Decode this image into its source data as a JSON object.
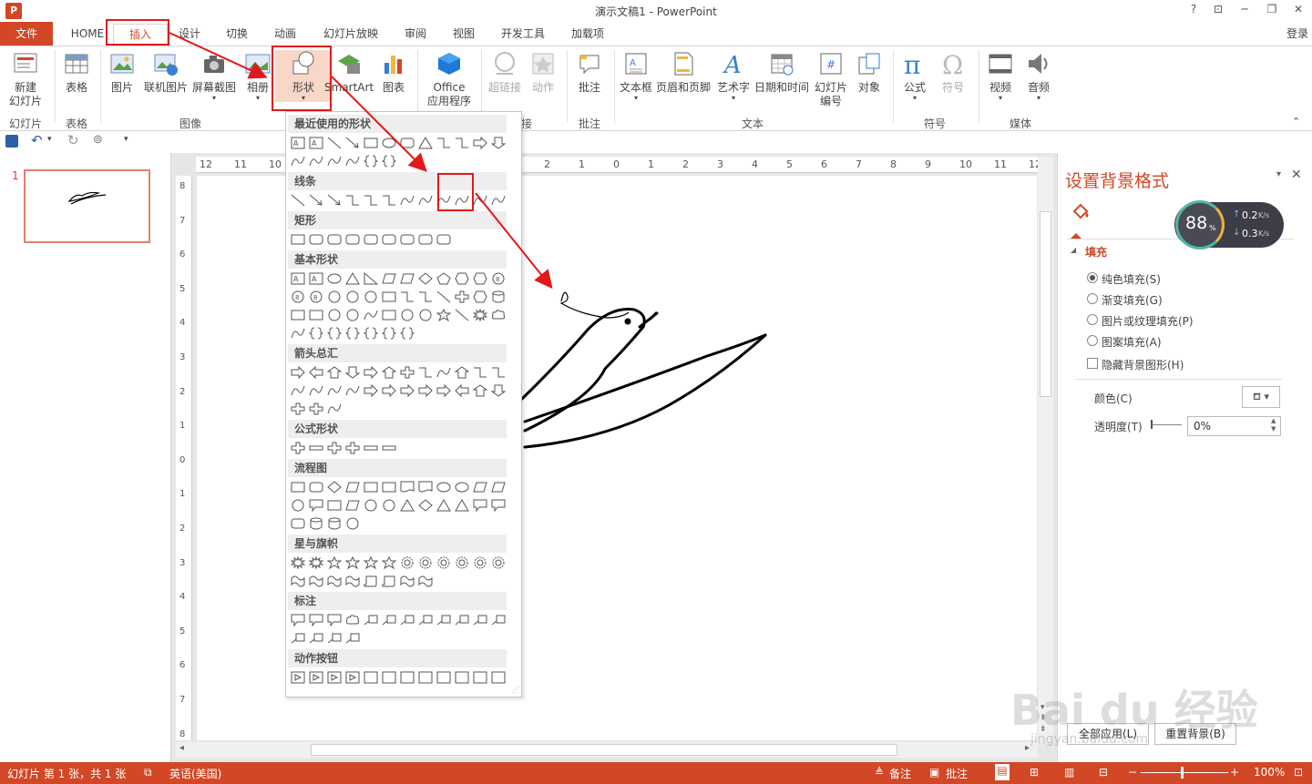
{
  "window": {
    "title": "演示文稿1 - PowerPoint",
    "app_icon": "P",
    "help": "?",
    "login": "登录"
  },
  "tabs": [
    {
      "label": "文件"
    },
    {
      "label": "HOME"
    },
    {
      "label": "插入"
    },
    {
      "label": "设计"
    },
    {
      "label": "切换"
    },
    {
      "label": "动画"
    },
    {
      "label": "幻灯片放映"
    },
    {
      "label": "审阅"
    },
    {
      "label": "视图"
    },
    {
      "label": "开发工具"
    },
    {
      "label": "加载项"
    }
  ],
  "ribbon": {
    "buttons": {
      "new_slide": "新建\n幻灯片",
      "table": "表格",
      "picture": "图片",
      "online_picture": "联机图片",
      "screenshot": "屏幕截图",
      "album": "相册",
      "shapes": "形状",
      "smartart": "SmartArt",
      "chart": "图表",
      "office_apps": "Office\n应用程序",
      "hyperlink": "超链接",
      "action": "动作",
      "comment": "批注",
      "textbox": "文本框",
      "header_footer": "页眉和页脚",
      "wordart": "艺术字",
      "datetime": "日期和时间",
      "slide_number": "幻灯片\n编号",
      "object": "对象",
      "equation": "公式",
      "symbol": "符号",
      "video": "视频",
      "audio": "音频"
    },
    "groups": {
      "slides": "幻灯片",
      "tables": "表格",
      "images": "图像",
      "links": "接",
      "comments": "批注",
      "text": "文本",
      "symbols": "符号",
      "media": "媒体"
    }
  },
  "shapes_menu": {
    "categories": {
      "recent": "最近使用的形状",
      "lines": "线条",
      "rect": "矩形",
      "basic": "基本形状",
      "arrows": "箭头总汇",
      "equation": "公式形状",
      "flowchart": "流程图",
      "stars": "星与旗帜",
      "callouts": "标注",
      "action": "动作按钮"
    }
  },
  "ruler": {
    "h_ticks": [
      "12",
      "11",
      "10",
      "2",
      "1",
      "0",
      "1",
      "2",
      "3",
      "4",
      "5",
      "6",
      "7",
      "8",
      "9",
      "10",
      "11",
      "12"
    ],
    "v_ticks": [
      "8",
      "7",
      "6",
      "5",
      "4",
      "3",
      "2",
      "1",
      "0",
      "1",
      "2",
      "3",
      "4",
      "5",
      "6",
      "7",
      "8"
    ]
  },
  "thumbnails": {
    "number": "1"
  },
  "format_pane": {
    "title": "设置背景格式",
    "section": "填充",
    "options": [
      "纯色填充(S)",
      "渐变填充(G)",
      "图片或纹理填充(P)",
      "图案填充(A)"
    ],
    "hide_bg": "隐藏背景图形(H)",
    "color_label": "颜色(C)",
    "transparency_label": "透明度(T)",
    "transparency_value": "0%",
    "apply_all": "全部应用(L)",
    "reset": "重置背景(B)"
  },
  "net_widget": {
    "percent": "88",
    "percent_sign": "%",
    "up": "0.2",
    "down": "0.3",
    "unit": "K/s"
  },
  "watermark": {
    "text": "Bai du 经验",
    "url": "jingyan.baidu.com"
  },
  "status": {
    "slide_info": "幻灯片 第 1 张，共 1 张",
    "language": "英语(美国)",
    "notes": "备注",
    "comments": "批注",
    "zoom": "100%"
  },
  "colors": {
    "accent": "#d24726",
    "highlight": "#e3181b"
  }
}
